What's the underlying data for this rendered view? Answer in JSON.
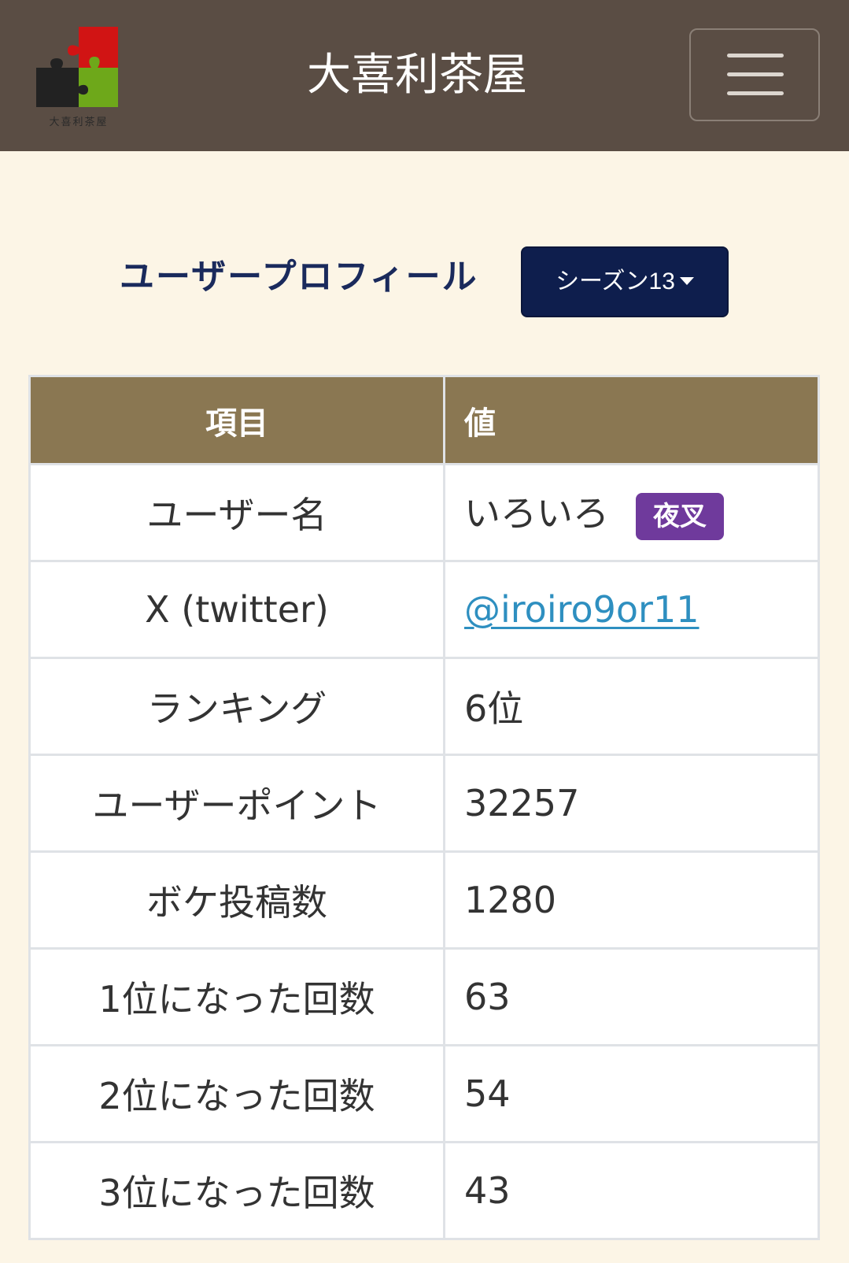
{
  "navbar": {
    "brand": "大喜利茶屋",
    "logo_caption": "大喜利茶屋",
    "logo_colors": {
      "red": "#d11414",
      "green": "#6ea81a",
      "black": "#222222"
    },
    "menu_icon": "hamburger-icon"
  },
  "profile": {
    "heading": "ユーザープロフィール",
    "season_label": "シーズン13"
  },
  "table": {
    "headers": {
      "key": "項目",
      "value": "値"
    },
    "rows": [
      {
        "key": "ユーザー名",
        "value": "いろいろ",
        "badge": "夜叉"
      },
      {
        "key": "X (twitter)",
        "value": "@iroiro9or11"
      },
      {
        "key": "ランキング",
        "value": "6位"
      },
      {
        "key": "ユーザーポイント",
        "value": "32257"
      },
      {
        "key": "ボケ投稿数",
        "value": "1280"
      },
      {
        "key": "1位になった回数",
        "value": "63"
      },
      {
        "key": "2位になった回数",
        "value": "54"
      },
      {
        "key": "3位になった回数",
        "value": "43"
      }
    ]
  },
  "colors": {
    "navbar_bg": "#5a4d44",
    "page_bg": "#fcf5e6",
    "table_header_bg": "#8a7752",
    "season_button_bg": "#0e1e4d",
    "badge_bg": "#6f3a9c",
    "link": "#2e8fc0"
  }
}
